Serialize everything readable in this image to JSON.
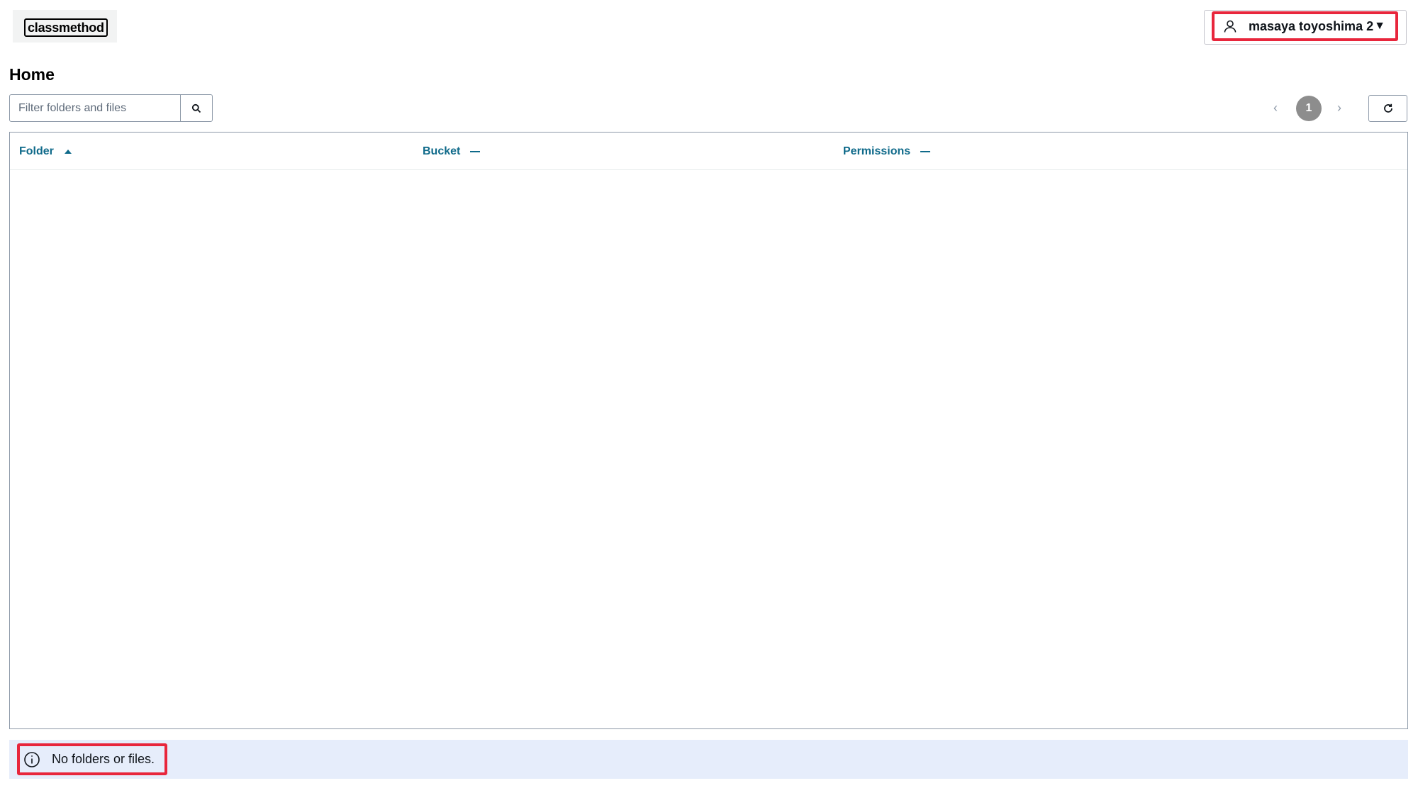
{
  "header": {
    "logo_text": "classmethod",
    "user_name": "masaya toyoshima 2",
    "user_icon": "user-icon",
    "caret": "▼"
  },
  "page": {
    "title": "Home"
  },
  "filter": {
    "placeholder": "Filter folders and files",
    "value": "",
    "button_icon": "search-icon"
  },
  "pagination": {
    "prev": "‹",
    "current_page": "1",
    "next": "›"
  },
  "toolbar": {
    "refresh_icon": "refresh-icon"
  },
  "table": {
    "columns": [
      {
        "label": "Folder",
        "sort": "ascending"
      },
      {
        "label": "Bucket",
        "sort": "none"
      },
      {
        "label": "Permissions",
        "sort": "none"
      }
    ],
    "rows": []
  },
  "flash": {
    "message": "No folders or files.",
    "icon": "info-icon"
  },
  "colors": {
    "accent_link": "#0f6a8a",
    "highlight_border": "#e8263c",
    "info_background": "#e6edfb",
    "pager_active": "#8d8d8d"
  }
}
